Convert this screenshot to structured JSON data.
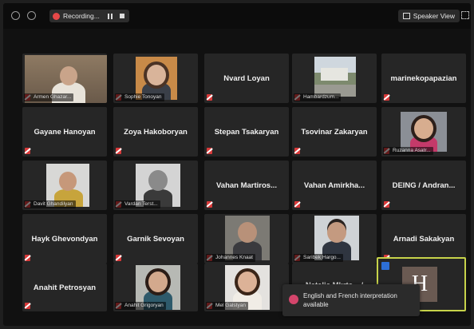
{
  "topbar": {
    "recording_label": "Recording...",
    "speaker_view_label": "Speaker View"
  },
  "participants": [
    {
      "id": "p1",
      "label": "Armen Ghazar..."
    },
    {
      "id": "p2",
      "label": "Sophie Tonoyan"
    },
    {
      "id": "p3",
      "name": "Nvard Loyan"
    },
    {
      "id": "p4",
      "label": "Hambardzum..."
    },
    {
      "id": "p5",
      "name": "marinekopapazian"
    },
    {
      "id": "p6",
      "name": "Gayane Hanoyan"
    },
    {
      "id": "p7",
      "name": "Zoya Hakoboryan"
    },
    {
      "id": "p8",
      "name": "Stepan Tsakaryan"
    },
    {
      "id": "p9",
      "name": "Tsovinar Zakaryan"
    },
    {
      "id": "p10",
      "label": "Ruzanna Asatr..."
    },
    {
      "id": "p11",
      "label": "Davit Ghandilyan"
    },
    {
      "id": "p12",
      "label": "Vardan Terst..."
    },
    {
      "id": "p13",
      "name": "Vahan Martiros..."
    },
    {
      "id": "p14",
      "name": "Vahan Amirkha..."
    },
    {
      "id": "p15",
      "name": "DEING / Andran..."
    },
    {
      "id": "p16",
      "name": "Hayk Ghevondyan"
    },
    {
      "id": "p17",
      "name": "Garnik Sevoyan"
    },
    {
      "id": "p18",
      "label": "Johannes Knaat"
    },
    {
      "id": "p19",
      "label": "Saribek Hargo..."
    },
    {
      "id": "p20",
      "name": "Arnadi Sakakyan"
    },
    {
      "id": "p21",
      "name": "Anahit Petrosyan"
    },
    {
      "id": "p22",
      "label": "Anahit Grigoryan"
    },
    {
      "id": "p23",
      "label": "Mel Galstyan"
    },
    {
      "id": "p24",
      "name": "Natalia Mkrtc... /"
    },
    {
      "id": "p25",
      "initial": "H"
    }
  ],
  "notice": {
    "line1": "English and French interpretation",
    "line2": "available"
  },
  "colors": {
    "active_speaker_border": "#c7d34a",
    "muted_red": "#d93a3a"
  }
}
